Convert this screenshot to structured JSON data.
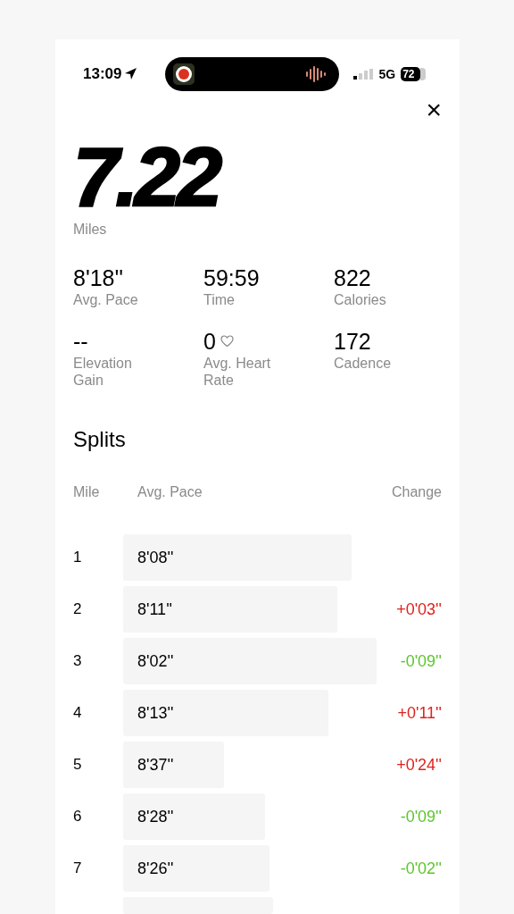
{
  "status_bar": {
    "time": "13:09",
    "network": "5G",
    "battery": "72"
  },
  "close_button": {
    "label": "×"
  },
  "distance": {
    "value": "7.22",
    "unit": "Miles"
  },
  "stats": [
    {
      "kind": "plain",
      "value": "8'18''",
      "label": "Avg. Pace"
    },
    {
      "kind": "plain",
      "value": "59:59",
      "label": "Time"
    },
    {
      "kind": "plain",
      "value": "822",
      "label": "Calories"
    },
    {
      "kind": "plain",
      "value": "--",
      "label": "Elevation Gain"
    },
    {
      "kind": "heart",
      "value": "0",
      "label": "Avg. Heart Rate"
    },
    {
      "kind": "plain",
      "value": "172",
      "label": "Cadence"
    }
  ],
  "splits": {
    "title": "Splits",
    "columns": [
      "Mile",
      "Avg. Pace",
      "Change"
    ],
    "rows": [
      {
        "kind": "split",
        "mile": "1",
        "pace": "8'08''"
      },
      {
        "kind": "split",
        "mile": "2",
        "pace": "8'11''",
        "change": "+0'03''",
        "color": "#e0221c"
      },
      {
        "kind": "split",
        "mile": "3",
        "pace": "8'02''",
        "change": "-0'09''",
        "color": "#5cc62c"
      },
      {
        "kind": "split",
        "mile": "4",
        "pace": "8'13''",
        "change": "+0'11''",
        "color": "#e0221c"
      },
      {
        "kind": "split",
        "mile": "5",
        "pace": "8'37''",
        "change": "+0'24''",
        "color": "#e0221c"
      },
      {
        "kind": "split",
        "mile": "6",
        "pace": "8'28''",
        "change": "-0'09''",
        "color": "#5cc62c"
      },
      {
        "kind": "split",
        "mile": "7",
        "pace": "8'26''",
        "change": "-0'02''",
        "color": "#5cc62c"
      },
      {
        "kind": "partial"
      }
    ]
  }
}
